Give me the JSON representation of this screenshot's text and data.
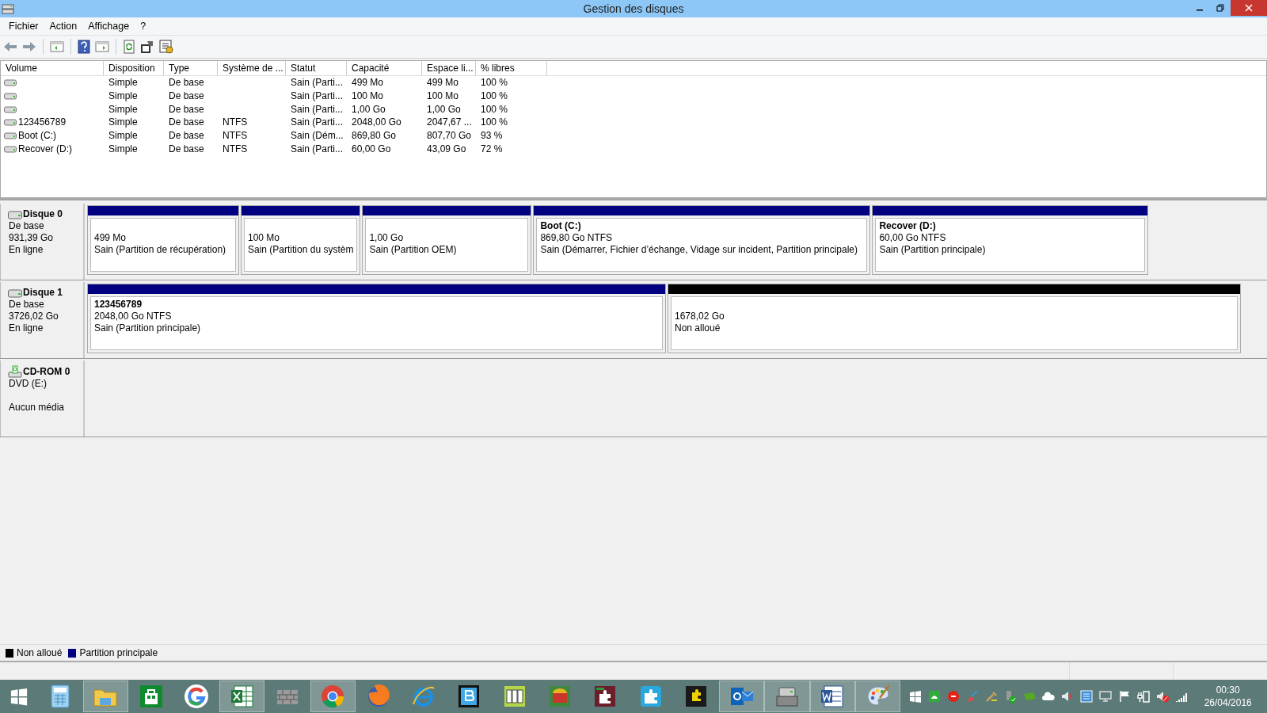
{
  "window": {
    "title": "Gestion des disques"
  },
  "menu": [
    "Fichier",
    "Action",
    "Affichage",
    "?"
  ],
  "table": {
    "columns": [
      "Volume",
      "Disposition",
      "Type",
      "Système de ...",
      "Statut",
      "Capacité",
      "Espace li...",
      "% libres"
    ],
    "rows": [
      {
        "cells": [
          "",
          "Simple",
          "De base",
          "",
          "Sain (Parti...",
          "499 Mo",
          "499 Mo",
          "100 %"
        ]
      },
      {
        "cells": [
          "",
          "Simple",
          "De base",
          "",
          "Sain (Parti...",
          "100 Mo",
          "100 Mo",
          "100 %"
        ]
      },
      {
        "cells": [
          "",
          "Simple",
          "De base",
          "",
          "Sain (Parti...",
          "1,00 Go",
          "1,00 Go",
          "100 %"
        ]
      },
      {
        "cells": [
          "123456789",
          "Simple",
          "De base",
          "NTFS",
          "Sain (Parti...",
          "2048,00 Go",
          "2047,67 ...",
          "100 %"
        ]
      },
      {
        "cells": [
          "Boot (C:)",
          "Simple",
          "De base",
          "NTFS",
          "Sain (Dém...",
          "869,80 Go",
          "807,70 Go",
          "93 %"
        ]
      },
      {
        "cells": [
          "Recover (D:)",
          "Simple",
          "De base",
          "NTFS",
          "Sain (Parti...",
          "60,00 Go",
          "43,09 Go",
          "72 %"
        ]
      }
    ]
  },
  "disks": [
    {
      "kind": "disk",
      "name": "Disque 0",
      "lines": [
        "De base",
        "931,39 Go",
        "En ligne"
      ],
      "partitions": [
        {
          "kind": "primary",
          "size": "499 Mo",
          "status": "Sain (Partition de récupération)"
        },
        {
          "kind": "primary",
          "size": "100 Mo",
          "status": "Sain (Partition du systèm"
        },
        {
          "kind": "primary",
          "size": "1,00 Go",
          "status": "Sain (Partition OEM)"
        },
        {
          "kind": "primary",
          "name": "Boot  (C:)",
          "size": "869,80 Go NTFS",
          "status": "Sain (Démarrer, Fichier d’échange, Vidage sur incident, Partition principale)"
        },
        {
          "kind": "primary",
          "name": "Recover  (D:)",
          "size": "60,00 Go NTFS",
          "status": "Sain (Partition principale)"
        }
      ]
    },
    {
      "kind": "disk",
      "name": "Disque 1",
      "lines": [
        "De base",
        "3726,02 Go",
        "En ligne"
      ],
      "partitions": [
        {
          "kind": "primary",
          "name": "123456789",
          "size": "2048,00 Go NTFS",
          "status": "Sain (Partition principale)"
        },
        {
          "kind": "unallocated",
          "size": "1678,02 Go",
          "status": "Non alloué"
        }
      ]
    },
    {
      "kind": "cdrom",
      "name": "CD-ROM 0",
      "lines": [
        "DVD (E:)",
        "Aucun média"
      ]
    }
  ],
  "legend": [
    {
      "label": "Non alloué",
      "color": "#000000"
    },
    {
      "label": "Partition principale",
      "color": "#000080"
    }
  ],
  "taskbar": {
    "apps": [
      {
        "running": false
      },
      {
        "running": true
      },
      {
        "running": false
      },
      {
        "running": false
      },
      {
        "running": true
      },
      {
        "running": false
      },
      {
        "running": true
      },
      {
        "running": false
      },
      {
        "running": false
      },
      {
        "running": false
      },
      {
        "running": false
      },
      {
        "running": false
      },
      {
        "running": false
      },
      {
        "running": false
      },
      {
        "running": false
      },
      {
        "running": true
      },
      {
        "running": true
      },
      {
        "running": true
      },
      {
        "running": true
      }
    ],
    "time": "00:30",
    "date": "26/04/2016"
  }
}
